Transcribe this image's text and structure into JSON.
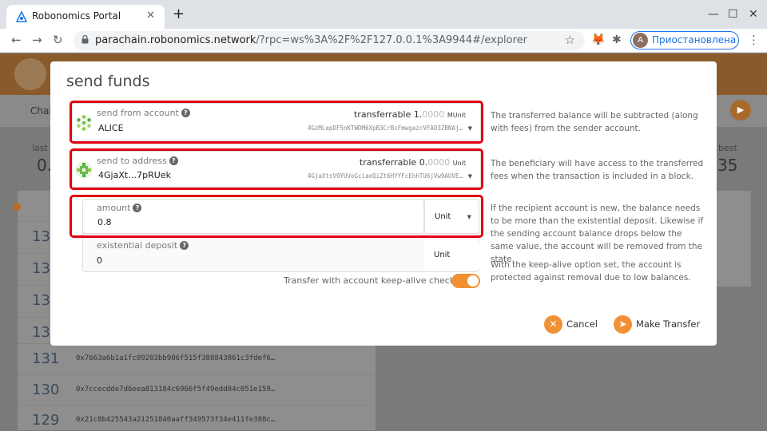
{
  "browser": {
    "tab_title": "Robonomics Portal",
    "url_host": "parachain.robonomics.network",
    "url_rest": "/?rpc=ws%3A%2F%2F127.0.0.1%3A9944#/explorer",
    "profile_initial": "A",
    "profile_label": "Приостановлена"
  },
  "background": {
    "tab_chain": "Chai",
    "stat_left_label": "last b",
    "stat_left_value": "0.",
    "stat_right_label": "best",
    "stat_right_value": "35",
    "blocks": [
      {
        "number": "13",
        "hash": ""
      },
      {
        "number": "13",
        "hash": ""
      },
      {
        "number": "13",
        "hash": ""
      },
      {
        "number": "13",
        "hash": ""
      },
      {
        "number": "131",
        "hash": "0x7663a6b1a1fc09203bb906f515f388843861c3fdef6…"
      },
      {
        "number": "130",
        "hash": "0x7ccecdde7d6eea813184c6966f5f49edd84c051e159…"
      },
      {
        "number": "129",
        "hash": "0x21c8b425543a21251840aaff349573f34e411fe388c…"
      }
    ]
  },
  "modal": {
    "title": "send funds",
    "from": {
      "label": "send from account",
      "name": "ALICE",
      "transfer_label": "transferrable",
      "transfer_int": "1.",
      "transfer_dec": "0000",
      "transfer_unit": "MUnit",
      "address": "4GzMLepDF5nKTWDM6XpB3CrBcFmwgazcVFAD3ZBNAj…",
      "hint": "The transferred balance will be subtracted (along with fees) from the sender account."
    },
    "to": {
      "label": "send to address",
      "name": "4GjaXt…7pRUek",
      "transfer_label": "transferrable",
      "transfer_int": "0.",
      "transfer_dec": "0000",
      "transfer_unit": "Unit",
      "address": "4GjaXtsV9YUVoGciaoQiZt6HYYFcEhhTU6jVw9AUVE…",
      "hint": "The beneficiary will have access to the transferred fees when the transaction is included in a block."
    },
    "amount": {
      "label": "amount",
      "value": "0.8",
      "unit": "Unit",
      "hint": "If the recipient account is new, the balance needs to be more than the existential deposit. Likewise if the sending account balance drops below the same value, the account will be removed from the state."
    },
    "existential": {
      "label": "existential deposit",
      "value": "0",
      "unit": "Unit",
      "hint": "With the keep-alive option set, the account is protected against removal due to low balances."
    },
    "keep_alive_label": "Transfer with account keep-alive checks",
    "keep_alive_on": true,
    "cancel_label": "Cancel",
    "submit_label": "Make Transfer"
  },
  "colors": {
    "accent": "#f19135",
    "highlight_box": "#e10010"
  }
}
